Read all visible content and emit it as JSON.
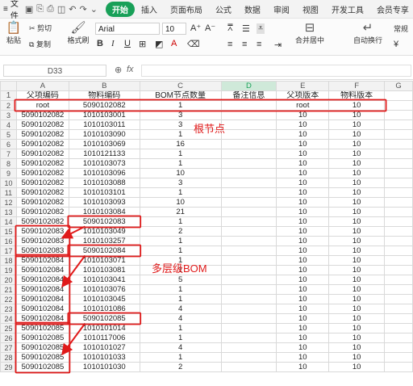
{
  "menu": {
    "file_label": "文件",
    "tabs": [
      "开始",
      "插入",
      "页面布局",
      "公式",
      "数据",
      "审阅",
      "视图",
      "开发工具",
      "会员专享"
    ]
  },
  "ribbon": {
    "paste": "粘贴",
    "cut": "剪切",
    "copy": "复制",
    "format_painter": "格式刷",
    "font_name": "Arial",
    "font_size": "10",
    "merge_center": "合并居中",
    "wrap_text": "自动换行",
    "number_format": "常规"
  },
  "formula_bar": {
    "cell_ref": "D33",
    "fx": "fx",
    "content": ""
  },
  "columns": [
    "A",
    "B",
    "C",
    "D",
    "E",
    "F",
    "G"
  ],
  "headers": [
    "父项编码",
    "物料编码",
    "BOM节点数量",
    "备注信息",
    "父项版本",
    "物料版本",
    ""
  ],
  "rows": [
    [
      "root",
      "5090102082",
      "1",
      "",
      "root",
      "10"
    ],
    [
      "5090102082",
      "1010103001",
      "3",
      "",
      "10",
      "10"
    ],
    [
      "5090102082",
      "1010103011",
      "3",
      "",
      "10",
      "10"
    ],
    [
      "5090102082",
      "1010103090",
      "1",
      "",
      "10",
      "10"
    ],
    [
      "5090102082",
      "1010103069",
      "16",
      "",
      "10",
      "10"
    ],
    [
      "5090102082",
      "1010121133",
      "1",
      "",
      "10",
      "10"
    ],
    [
      "5090102082",
      "1010103073",
      "1",
      "",
      "10",
      "10"
    ],
    [
      "5090102082",
      "1010103096",
      "10",
      "",
      "10",
      "10"
    ],
    [
      "5090102082",
      "1010103088",
      "3",
      "",
      "10",
      "10"
    ],
    [
      "5090102082",
      "1010103101",
      "1",
      "",
      "10",
      "10"
    ],
    [
      "5090102082",
      "1010103093",
      "10",
      "",
      "10",
      "10"
    ],
    [
      "5090102082",
      "1010103084",
      "21",
      "",
      "10",
      "10"
    ],
    [
      "5090102082",
      "5090102083",
      "1",
      "",
      "10",
      "10"
    ],
    [
      "5090102083",
      "1010103049",
      "2",
      "",
      "10",
      "10"
    ],
    [
      "5090102083",
      "1010103257",
      "1",
      "",
      "10",
      "10"
    ],
    [
      "5090102083",
      "5090102084",
      "1",
      "",
      "10",
      "10"
    ],
    [
      "5090102084",
      "1010103071",
      "1",
      "",
      "10",
      "10"
    ],
    [
      "5090102084",
      "1010103081",
      "1",
      "",
      "10",
      "10"
    ],
    [
      "5090102084",
      "1010103041",
      "5",
      "",
      "10",
      "10"
    ],
    [
      "5090102084",
      "1010103076",
      "1",
      "",
      "10",
      "10"
    ],
    [
      "5090102084",
      "1010103045",
      "1",
      "",
      "10",
      "10"
    ],
    [
      "5090102084",
      "1010101086",
      "4",
      "",
      "10",
      "10"
    ],
    [
      "5090102084",
      "5090102085",
      "4",
      "",
      "10",
      "10"
    ],
    [
      "5090102085",
      "1010101014",
      "1",
      "",
      "10",
      "10"
    ],
    [
      "5090102085",
      "1010117006",
      "1",
      "",
      "10",
      "10"
    ],
    [
      "5090102085",
      "1010101027",
      "4",
      "",
      "10",
      "10"
    ],
    [
      "5090102085",
      "1010101033",
      "1",
      "",
      "10",
      "10"
    ],
    [
      "5090102085",
      "1010101030",
      "2",
      "",
      "10",
      "10"
    ]
  ],
  "annotations": {
    "root_node": "根节点",
    "multi_level_bom": "多层级BOM"
  }
}
